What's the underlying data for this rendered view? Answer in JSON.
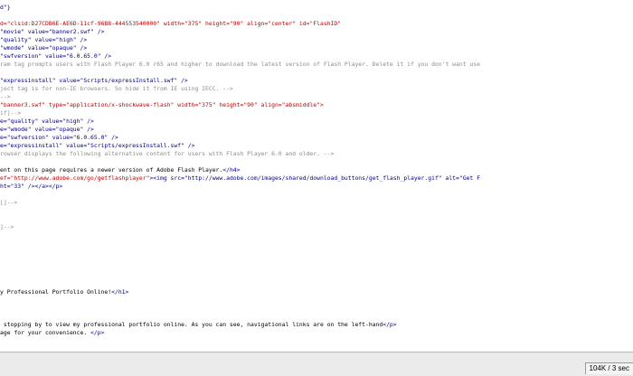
{
  "colors": {
    "background": "#ffffff",
    "text": "#000000",
    "tag": "#000080",
    "attr_value": "#c00000",
    "comment": "#8c8c8c",
    "statusbar": "#ebebeb"
  },
  "code_lines": [
    {
      "segments": [
        {
          "t": "d\"}",
          "k": "tag"
        }
      ]
    },
    {
      "segments": []
    },
    {
      "segments": [
        {
          "t": "d=\"clsid:D27CDB6E-AE6D-11cf-96B8-444553540000\" width=\"375\" height=\"90\" align=\"center\" id=\"FlashID\"",
          "k": "attr"
        }
      ]
    },
    {
      "segments": [
        {
          "t": "\"movie\" value=\"banner2.swf\" />",
          "k": "tag"
        }
      ]
    },
    {
      "segments": [
        {
          "t": "\"quality\" value=\"high\" />",
          "k": "tag"
        }
      ]
    },
    {
      "segments": [
        {
          "t": "\"wmode\" value=\"opaque\" />",
          "k": "tag"
        }
      ]
    },
    {
      "segments": [
        {
          "t": "\"swfversion\" value=\"6.0.65.0\" />",
          "k": "tag"
        }
      ]
    },
    {
      "segments": [
        {
          "t": "ram tag prompts users with Flash Player 6.0 r65 and higher to download the latest version of Flash Player. Delete it if you don't want use",
          "k": "comment"
        }
      ]
    },
    {
      "segments": []
    },
    {
      "segments": [
        {
          "t": "\"expressinstall\" value=\"Scripts/expressInstall.swf\" />",
          "k": "tag"
        }
      ]
    },
    {
      "segments": [
        {
          "t": "ject tag is for non-IE browsers. So hide it from IE using IECC. -->",
          "k": "comment"
        }
      ]
    },
    {
      "segments": [
        {
          "t": "-->",
          "k": "comment"
        }
      ]
    },
    {
      "segments": [
        {
          "t": "\"banner3.swf\" type=\"application/x-shockwave-flash\" width=\"375\" height=\"90\" align=\"absmiddle\">",
          "k": "attr"
        }
      ]
    },
    {
      "segments": [
        {
          "t": "if]-->",
          "k": "comment"
        }
      ]
    },
    {
      "segments": [
        {
          "t": "e=\"quality\" value=\"high\" />",
          "k": "tag"
        }
      ]
    },
    {
      "segments": [
        {
          "t": "e=\"wmode\" value=\"opaque\" />",
          "k": "tag"
        }
      ]
    },
    {
      "segments": [
        {
          "t": "e=\"swfversion\" value=\"6.0.65.0\" />",
          "k": "tag"
        }
      ]
    },
    {
      "segments": [
        {
          "t": "e=\"expressinstall\" value=\"Scripts/expressInstall.swf\" />",
          "k": "tag"
        }
      ]
    },
    {
      "segments": [
        {
          "t": "rowser displays the following alternative content for users with Flash Player 6.0 and older. -->",
          "k": "comment"
        }
      ]
    },
    {
      "segments": []
    },
    {
      "segments": [
        {
          "t": "ent on this page requires a newer version of Adobe Flash Player.",
          "k": "text"
        },
        {
          "t": "</h4>",
          "k": "tag"
        }
      ]
    },
    {
      "segments": [
        {
          "t": "ef=\"http://www.adobe.com/go/getflashplayer\"",
          "k": "attr"
        },
        {
          "t": "><img src=\"http://www.adobe.com/images/shared/download_buttons/get_flash_player.gif\" alt=\"Get F",
          "k": "tag"
        }
      ]
    },
    {
      "segments": [
        {
          "t": "ht=\"33\" /></a></p>",
          "k": "tag"
        }
      ]
    },
    {
      "segments": []
    },
    {
      "segments": [
        {
          "t": "[]-->",
          "k": "comment"
        }
      ]
    },
    {
      "segments": []
    },
    {
      "segments": []
    },
    {
      "segments": [
        {
          "t": "]-->",
          "k": "comment"
        }
      ]
    },
    {
      "segments": []
    },
    {
      "segments": []
    },
    {
      "segments": []
    },
    {
      "segments": []
    },
    {
      "segments": []
    },
    {
      "segments": []
    },
    {
      "segments": []
    },
    {
      "segments": [
        {
          "t": "y Professional Portfolio Online!",
          "k": "text"
        },
        {
          "t": "</h1>",
          "k": "tag"
        }
      ]
    },
    {
      "segments": []
    },
    {
      "segments": []
    },
    {
      "segments": []
    },
    {
      "segments": [
        {
          "t": " stopping by to view my professional portfolio online. As you can see, navigational links are on the left-hand",
          "k": "text"
        },
        {
          "t": "</p>",
          "k": "tag"
        }
      ]
    },
    {
      "segments": [
        {
          "t": "age for your convenience. ",
          "k": "text"
        },
        {
          "t": "</p>",
          "k": "tag"
        }
      ]
    },
    {
      "segments": []
    }
  ],
  "statusbar": {
    "readout": "104K / 3 sec"
  }
}
